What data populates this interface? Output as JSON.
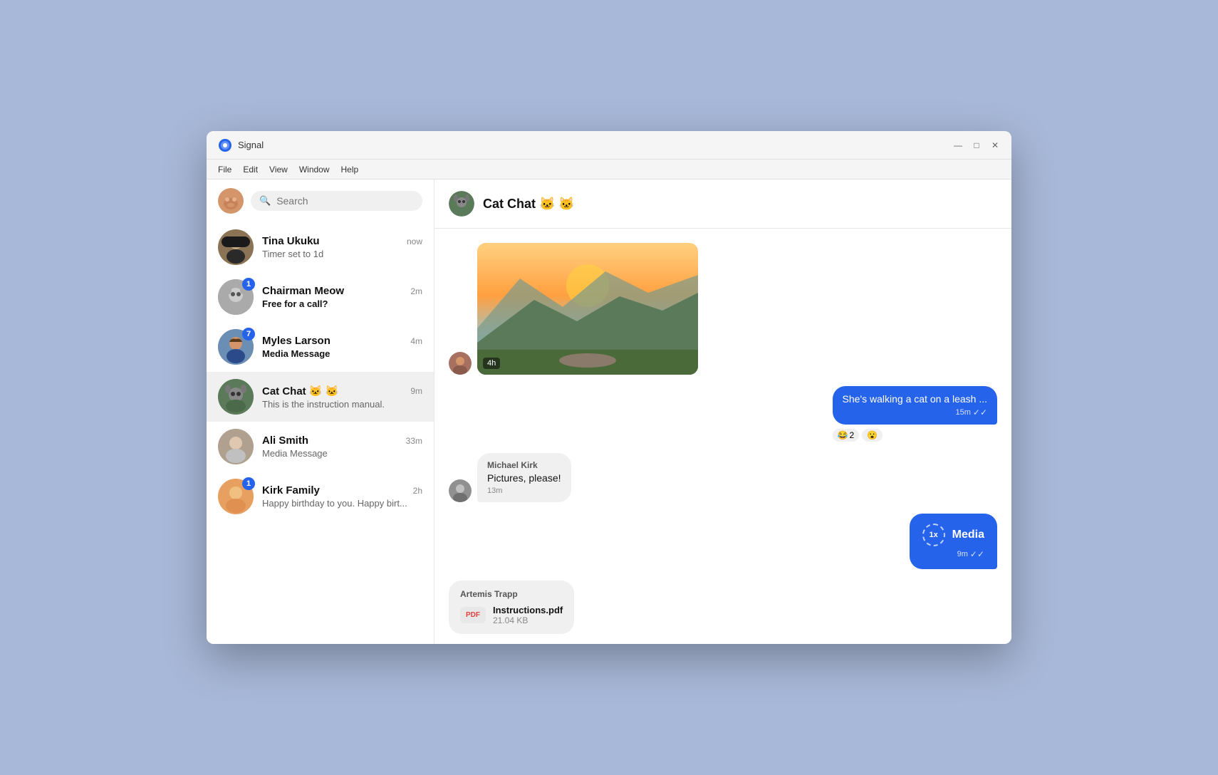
{
  "window": {
    "title": "Signal",
    "controls": {
      "minimize": "—",
      "maximize": "□",
      "close": "✕"
    }
  },
  "menu": {
    "items": [
      "File",
      "Edit",
      "View",
      "Window",
      "Help"
    ]
  },
  "sidebar": {
    "search_placeholder": "Search",
    "conversations": [
      {
        "id": "tina",
        "name": "Tina Ukuku",
        "preview": "Timer set to 1d",
        "time": "now",
        "badge": 0,
        "bold_preview": false,
        "avatar_color": "#c8a882",
        "avatar_emoji": ""
      },
      {
        "id": "chairman",
        "name": "Chairman Meow",
        "preview": "Free for a call?",
        "time": "2m",
        "badge": 1,
        "bold_preview": true,
        "avatar_color": "#999",
        "avatar_emoji": ""
      },
      {
        "id": "myles",
        "name": "Myles Larson",
        "preview": "Media Message",
        "time": "4m",
        "badge": 7,
        "bold_preview": true,
        "avatar_color": "#6b8eb5",
        "avatar_emoji": ""
      },
      {
        "id": "catchat",
        "name": "Cat Chat 🐱 🐱",
        "preview": "This is the instruction manual.",
        "time": "9m",
        "badge": 0,
        "bold_preview": false,
        "avatar_color": "#5a7a5a",
        "avatar_emoji": "",
        "active": true
      },
      {
        "id": "ali",
        "name": "Ali Smith",
        "preview": "Media Message",
        "time": "33m",
        "badge": 0,
        "bold_preview": false,
        "avatar_color": "#b0a090",
        "avatar_emoji": ""
      },
      {
        "id": "kirkfamily",
        "name": "Kirk Family",
        "preview": "Happy birthday to you. Happy birt...",
        "time": "2h",
        "badge": 1,
        "bold_preview": false,
        "avatar_color": "#e8a060",
        "avatar_emoji": ""
      }
    ]
  },
  "chat": {
    "title": "Cat Chat 🐱 🐱",
    "avatar_emoji": "🐱",
    "messages": [
      {
        "id": "msg1",
        "type": "image",
        "direction": "incoming",
        "time_overlay": "4h",
        "has_avatar": true
      },
      {
        "id": "msg2",
        "type": "text",
        "direction": "outgoing",
        "text": "She's walking a cat on a leash ...",
        "time": "15m",
        "reactions": [
          {
            "emoji": "😂",
            "count": "2"
          },
          {
            "emoji": "😮",
            "count": ""
          }
        ]
      },
      {
        "id": "msg3",
        "type": "text",
        "direction": "incoming",
        "sender": "Michael Kirk",
        "text": "Pictures, please!",
        "time": "13m",
        "has_avatar": true
      },
      {
        "id": "msg4",
        "type": "media",
        "direction": "outgoing",
        "label": "Media",
        "badge": "1x",
        "time": "9m"
      },
      {
        "id": "msg5",
        "type": "pdf",
        "direction": "incoming",
        "sender": "Artemis Trapp",
        "filename": "Instructions.pdf",
        "filesize": "21.04 KB",
        "filetype": "PDF",
        "has_avatar": false
      }
    ]
  },
  "colors": {
    "accent": "#2563eb",
    "background": "#a8b8d8",
    "sidebar_bg": "#ffffff",
    "chat_bg": "#ffffff"
  }
}
